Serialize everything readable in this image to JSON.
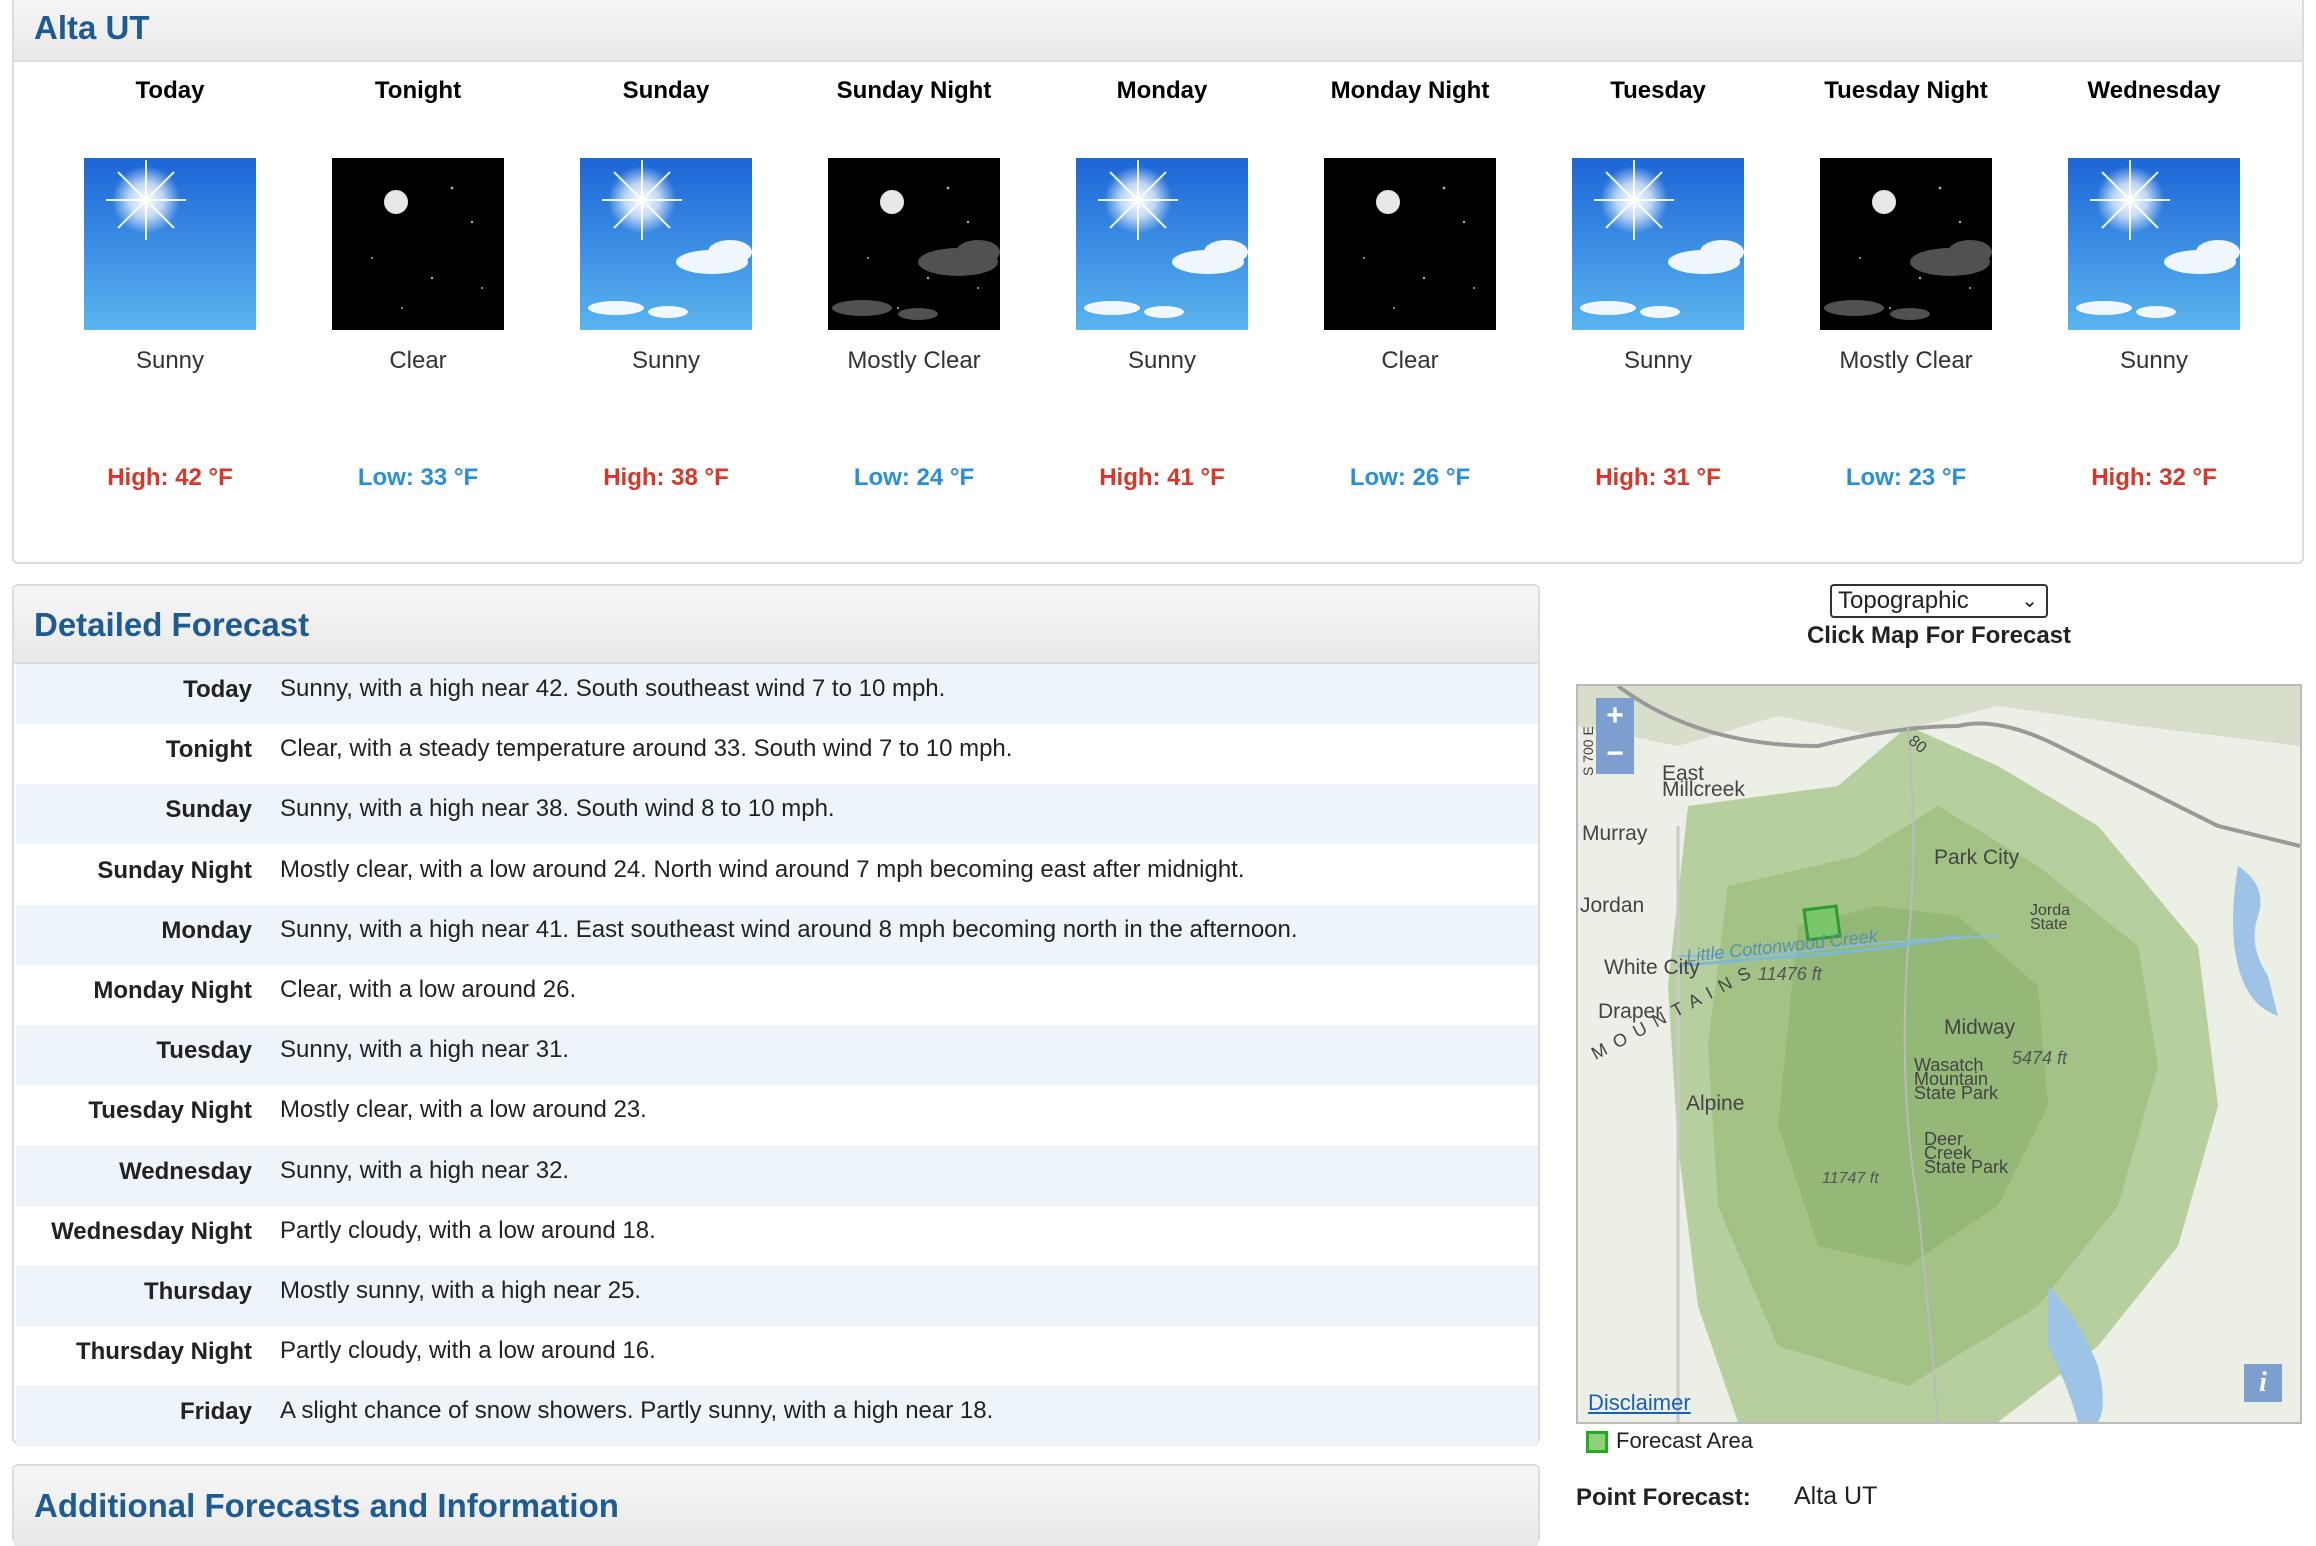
{
  "location": {
    "title": "Alta UT"
  },
  "tombstones": [
    {
      "name": "Today",
      "icon": "sunny-icon",
      "short": "Sunny",
      "temp": "High: 42 °F",
      "kind": "high"
    },
    {
      "name": "Tonight",
      "icon": "clear-night-icon",
      "short": "Clear",
      "temp": "Low: 33 °F",
      "kind": "low"
    },
    {
      "name": "Sunday",
      "icon": "sunny-icon",
      "short": "Sunny",
      "temp": "High: 38 °F",
      "kind": "high"
    },
    {
      "name": "Sunday Night",
      "icon": "mostly-clear-night-icon",
      "short": "Mostly Clear",
      "temp": "Low: 24 °F",
      "kind": "low"
    },
    {
      "name": "Monday",
      "icon": "sunny-icon",
      "short": "Sunny",
      "temp": "High: 41 °F",
      "kind": "high"
    },
    {
      "name": "Monday Night",
      "icon": "clear-night-icon",
      "short": "Clear",
      "temp": "Low: 26 °F",
      "kind": "low"
    },
    {
      "name": "Tuesday",
      "icon": "sunny-icon",
      "short": "Sunny",
      "temp": "High: 31 °F",
      "kind": "high"
    },
    {
      "name": "Tuesday Night",
      "icon": "mostly-clear-night-icon",
      "short": "Mostly Clear",
      "temp": "Low: 23 °F",
      "kind": "low"
    },
    {
      "name": "Wednesday",
      "icon": "sunny-icon",
      "short": "Sunny",
      "temp": "High: 32 °F",
      "kind": "high"
    }
  ],
  "detailed": {
    "title": "Detailed Forecast",
    "rows": [
      {
        "label": "Today",
        "text": "Sunny, with a high near 42. South southeast wind 7 to 10 mph."
      },
      {
        "label": "Tonight",
        "text": "Clear, with a steady temperature around 33. South wind 7 to 10 mph."
      },
      {
        "label": "Sunday",
        "text": "Sunny, with a high near 38. South wind 8 to 10 mph."
      },
      {
        "label": "Sunday Night",
        "text": "Mostly clear, with a low around 24. North wind around 7 mph becoming east after midnight."
      },
      {
        "label": "Monday",
        "text": "Sunny, with a high near 41. East southeast wind around 8 mph becoming north in the afternoon."
      },
      {
        "label": "Monday Night",
        "text": "Clear, with a low around 26."
      },
      {
        "label": "Tuesday",
        "text": "Sunny, with a high near 31."
      },
      {
        "label": "Tuesday Night",
        "text": "Mostly clear, with a low around 23."
      },
      {
        "label": "Wednesday",
        "text": "Sunny, with a high near 32."
      },
      {
        "label": "Wednesday Night",
        "text": "Partly cloudy, with a low around 18."
      },
      {
        "label": "Thursday",
        "text": "Mostly sunny, with a high near 25."
      },
      {
        "label": "Thursday Night",
        "text": "Partly cloudy, with a low around 16."
      },
      {
        "label": "Friday",
        "text": "A slight chance of snow showers. Partly sunny, with a high near 18."
      }
    ]
  },
  "additional": {
    "title": "Additional Forecasts and Information"
  },
  "map": {
    "layer_select": "Topographic",
    "click_hint": "Click Map For Forecast",
    "zoom_in": "+",
    "zoom_out": "−",
    "labels": {
      "east_millcreek": "East\nMillcreek",
      "murray": "Murray",
      "jordan": "Jordan",
      "white_city": "White City",
      "draper": "Draper",
      "park_city": "Park City",
      "midway": "Midway",
      "alpine": "Alpine",
      "wasatch": "Wasatch\nMountain\nState Park",
      "deer_creek": "Deer\nCreek\nState Park",
      "little_cottonwood": "Little Cottonwood Creek",
      "elev_11476": "11476 ft",
      "elev_5474": "5474 ft",
      "elev_11747": "11747 ft",
      "mountains": "M O U N T A I N S",
      "jordanelle": "Jorda\nState",
      "hwy80": "80",
      "street": "S 700 E"
    },
    "disclaimer": "Disclaimer",
    "info": "i",
    "legend": "Forecast Area"
  },
  "point_forecast": {
    "label": "Point Forecast:",
    "value": "Alta UT"
  }
}
